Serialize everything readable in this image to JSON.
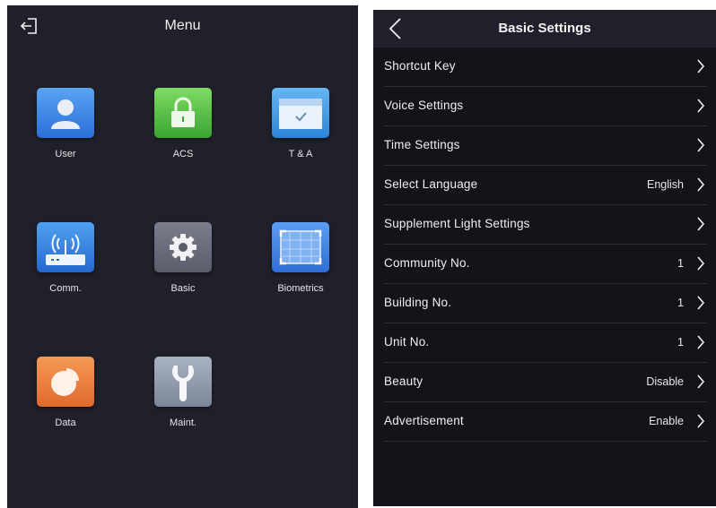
{
  "menu": {
    "title": "Menu",
    "tiles": [
      {
        "label": "User",
        "icon": "user-icon"
      },
      {
        "label": "ACS",
        "icon": "lock-icon"
      },
      {
        "label": "T & A",
        "icon": "calendar-check-icon"
      },
      {
        "label": "Comm.",
        "icon": "router-icon"
      },
      {
        "label": "Basic",
        "icon": "gear-icon"
      },
      {
        "label": "Biometrics",
        "icon": "face-frame-icon"
      },
      {
        "label": "Data",
        "icon": "pie-chart-icon"
      },
      {
        "label": "Maint.",
        "icon": "wrench-icon"
      }
    ]
  },
  "settings": {
    "title": "Basic Settings",
    "rows": [
      {
        "label": "Shortcut Key",
        "value": ""
      },
      {
        "label": "Voice Settings",
        "value": ""
      },
      {
        "label": "Time Settings",
        "value": ""
      },
      {
        "label": "Select Language",
        "value": "English"
      },
      {
        "label": "Supplement Light Settings",
        "value": ""
      },
      {
        "label": "Community No.",
        "value": "1"
      },
      {
        "label": "Building No.",
        "value": "1"
      },
      {
        "label": "Unit No.",
        "value": "1"
      },
      {
        "label": "Beauty",
        "value": "Disable"
      },
      {
        "label": "Advertisement",
        "value": "Enable"
      }
    ]
  },
  "colors": {
    "panel_bg": "#1f2029",
    "list_bg": "#13141a",
    "divider": "#2e3038",
    "text": "#f0f0f0"
  }
}
